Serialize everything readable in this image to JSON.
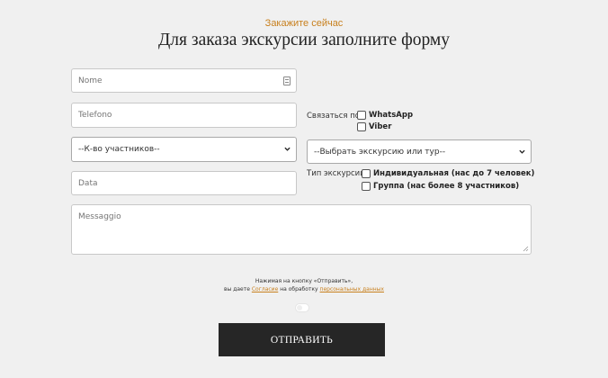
{
  "header": {
    "subtitle": "Закажите сейчас",
    "title": "Для заказа экскурсии заполните форму"
  },
  "form": {
    "name_placeholder": "Nome",
    "phone_placeholder": "Telefono",
    "participants_select": "--К-во участников--",
    "date_placeholder": "Data",
    "message_placeholder": "Messaggio",
    "contact_label": "Связаться по:",
    "contact_options": [
      "WhatsApp",
      "Viber"
    ],
    "tour_select": "--Выбрать экскурсию или тур--",
    "tour_type_label": "Тип экскурсии:",
    "tour_type_options": [
      "Индивидуальная (нас до 7 человек)",
      "Группа (нас более 8 участников)"
    ]
  },
  "consent": {
    "line1": "Нажимая на кнопку «Отправить»,",
    "line2_prefix": "вы даете",
    "agreement_link": "Согласие",
    "line2_middle": "на обработку",
    "personal_data_link": "персональных данных"
  },
  "submit_label": "ОТПРАВИТЬ",
  "colors": {
    "accent": "#c8801e",
    "button": "#262626",
    "background": "#f0f0f0"
  },
  "icons": {
    "name_field": "id-card-icon",
    "select": "chevron-down-icon"
  }
}
